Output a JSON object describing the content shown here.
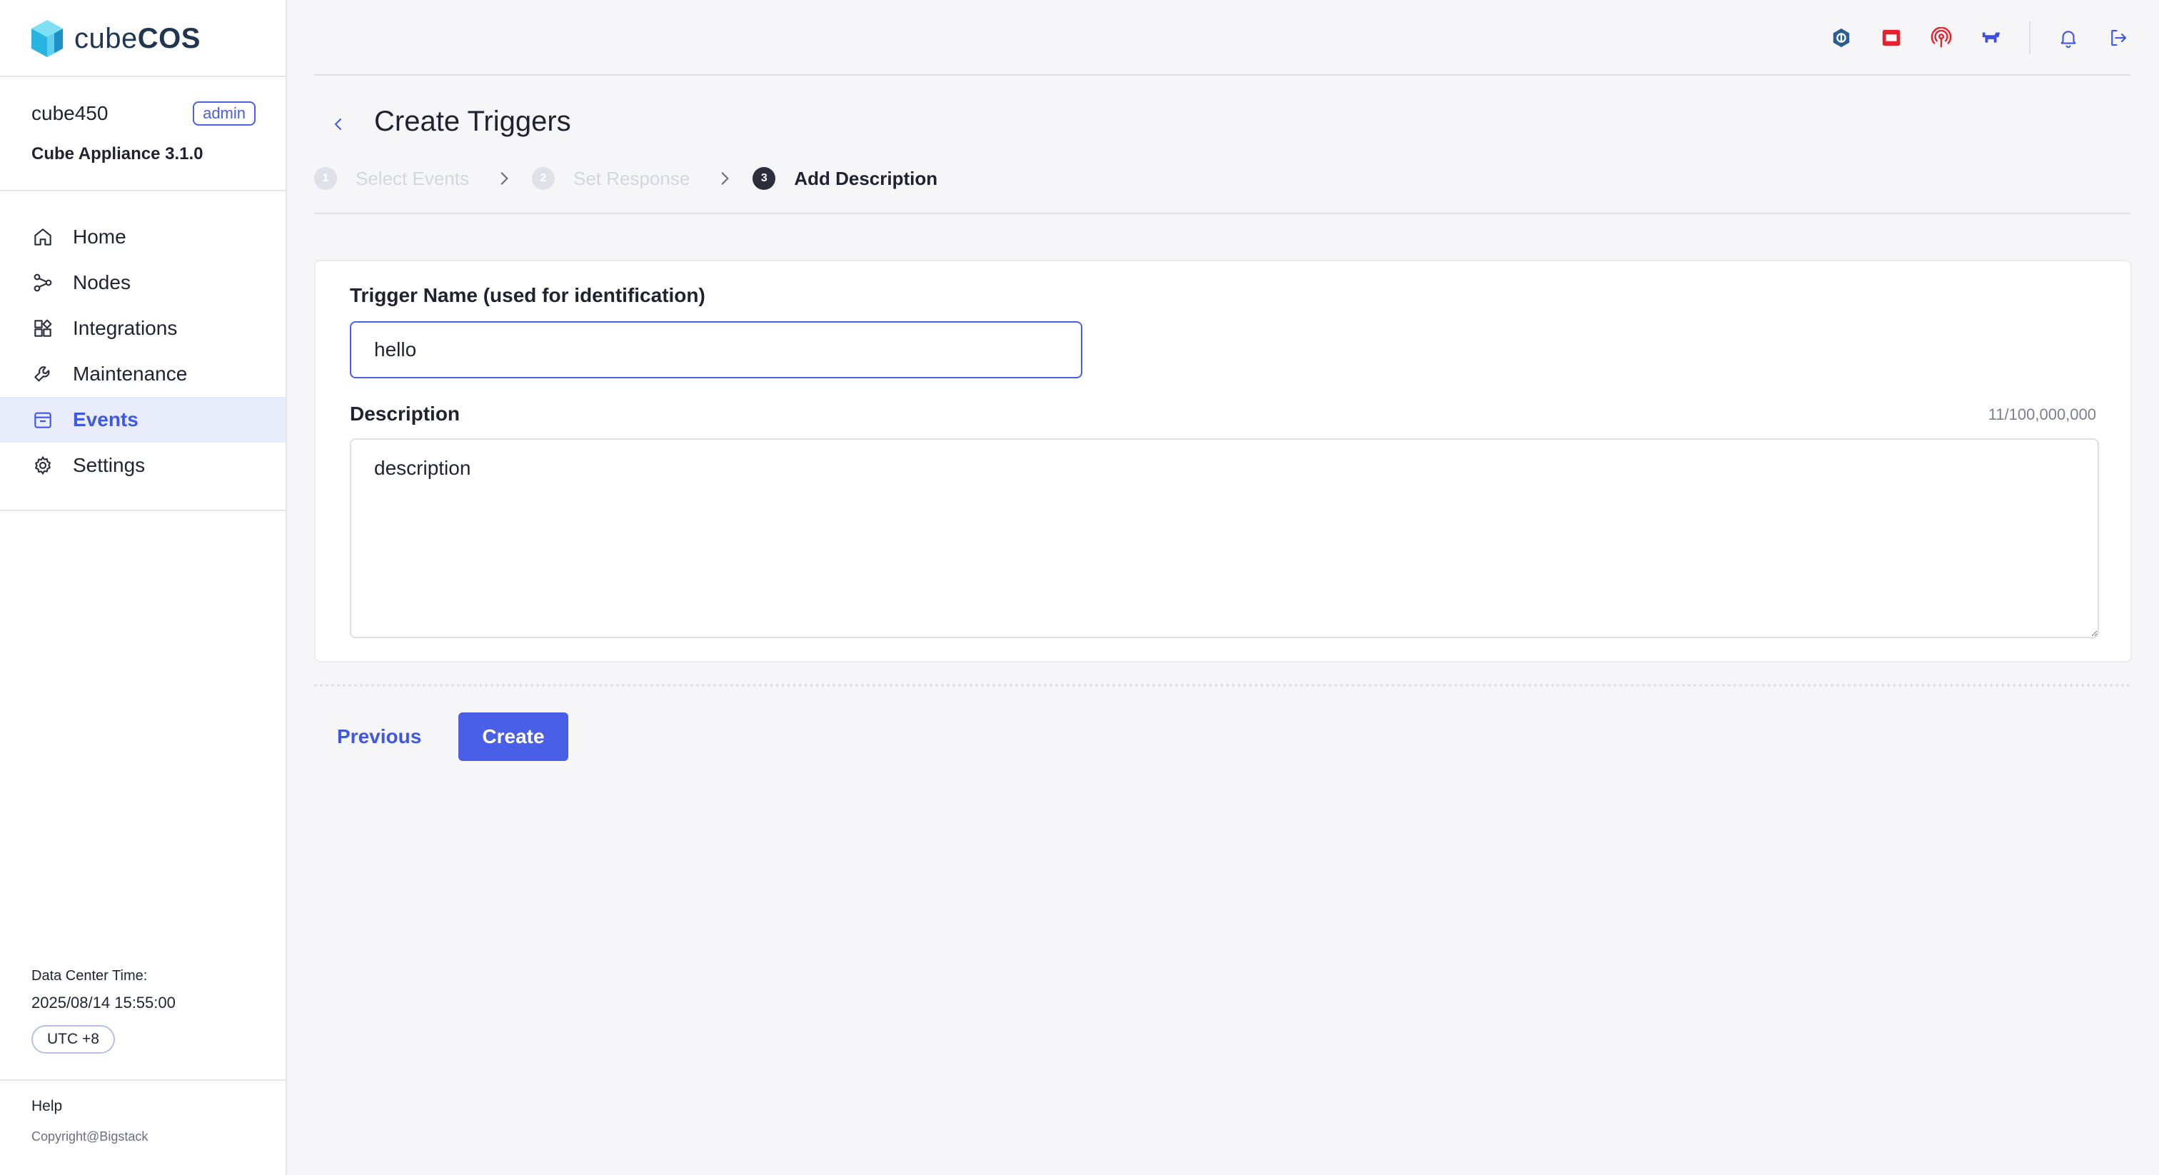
{
  "app": {
    "logo_prefix": "cube",
    "logo_suffix": "COS"
  },
  "user": {
    "name": "cube450",
    "role": "admin",
    "version": "Cube Appliance 3.1.0"
  },
  "nav": {
    "items": [
      {
        "label": "Home",
        "icon": "home-icon"
      },
      {
        "label": "Nodes",
        "icon": "nodes-icon"
      },
      {
        "label": "Integrations",
        "icon": "integrations-icon"
      },
      {
        "label": "Maintenance",
        "icon": "wrench-icon"
      },
      {
        "label": "Events",
        "icon": "events-icon",
        "active": true
      },
      {
        "label": "Settings",
        "icon": "gear-icon"
      }
    ]
  },
  "footer": {
    "dc_label": "Data Center Time:",
    "dc_time": "2025/08/14 15:55:00",
    "timezone": "UTC +8",
    "help": "Help",
    "copyright": "Copyright@Bigstack"
  },
  "topbar": {
    "icons": [
      "ceph-icon",
      "openstack-icon",
      "signal-icon",
      "rancher-icon",
      "bell-icon",
      "logout-icon"
    ]
  },
  "page": {
    "title": "Create Triggers",
    "steps": [
      {
        "num": "1",
        "label": "Select Events",
        "state": "done"
      },
      {
        "num": "2",
        "label": "Set Response",
        "state": "done"
      },
      {
        "num": "3",
        "label": "Add Description",
        "state": "current"
      }
    ]
  },
  "form": {
    "name_label": "Trigger Name (used for identification)",
    "name_value": "hello",
    "desc_label": "Description",
    "desc_value": "description",
    "counter": "11/100,000,000"
  },
  "actions": {
    "previous": "Previous",
    "create": "Create"
  },
  "colors": {
    "accent": "#4a5fe8",
    "active_nav_bg": "#e9ecfb",
    "ceph_icon": "#2c5d8f",
    "openstack_icon": "#e8222d",
    "rancher_icon": "#3c4ee5"
  }
}
